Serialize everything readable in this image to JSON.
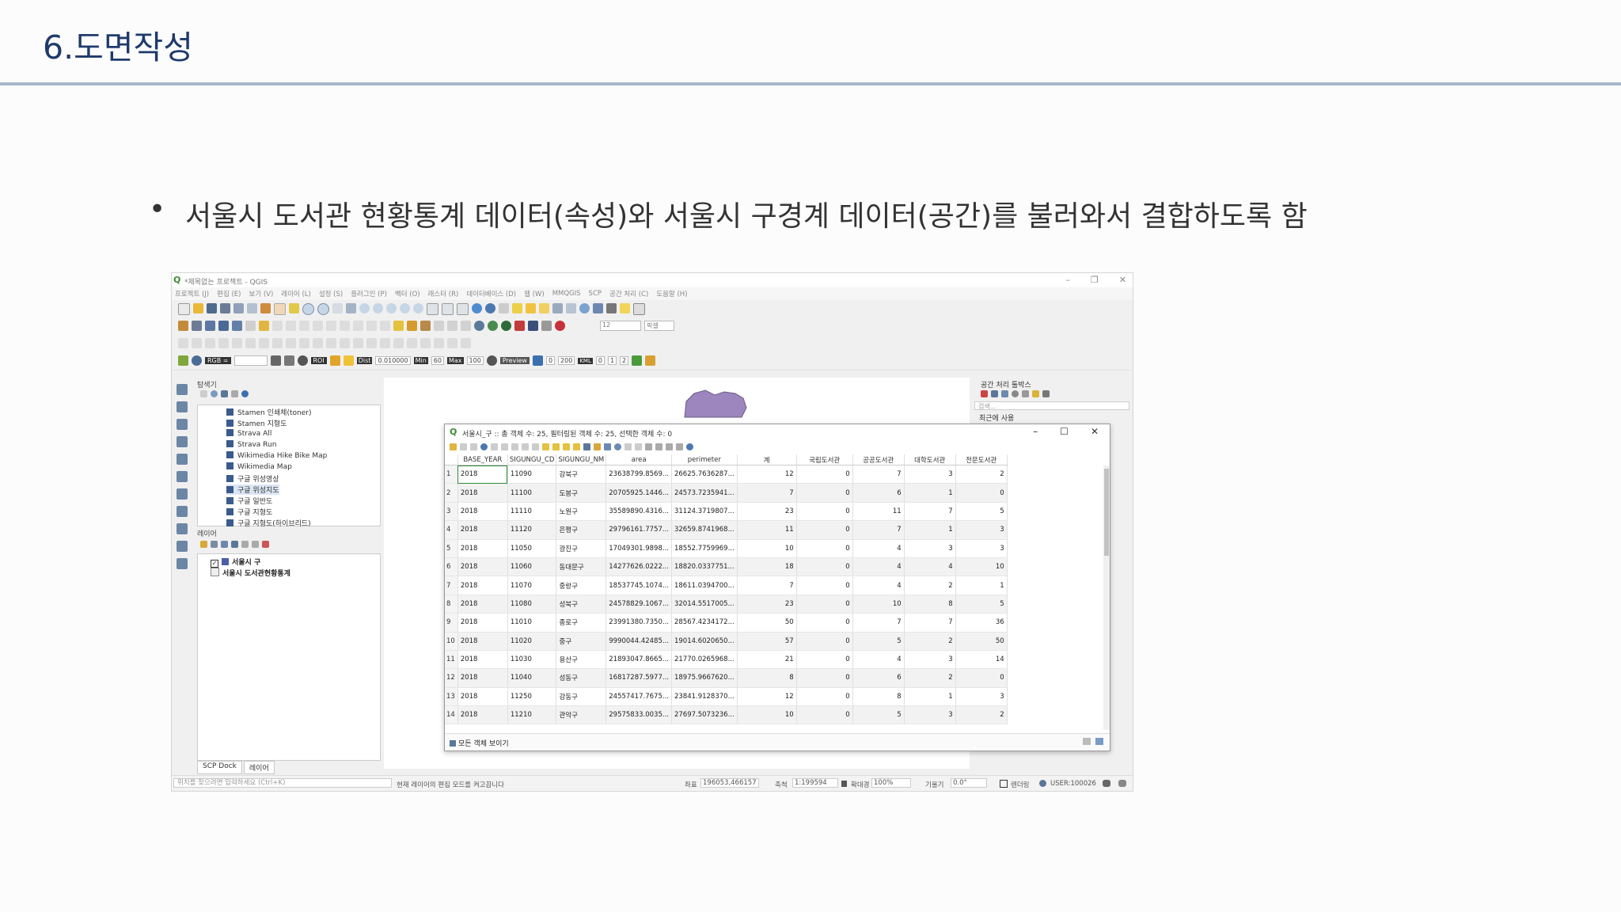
{
  "slide": {
    "title": "6.도면작성",
    "bullet_marker": "•",
    "bullet": "서울시 도서관 현황통계 데이터(속성)와 서울시 구경계 데이터(공간)를 불러와서 결합하도록 함"
  },
  "qgis": {
    "window_title": "*제목없는 프로젝트 - QGIS",
    "window_buttons": [
      "–",
      "❐",
      "✕"
    ],
    "menu": [
      "프로젝트 (J)",
      "편집 (E)",
      "보기 (V)",
      "레이어 (L)",
      "설정 (S)",
      "플러그인 (P)",
      "벡터 (O)",
      "래스터 (R)",
      "데이터베이스 (D)",
      "웹 (W)",
      "MMQGIS",
      "SCP",
      "공간 처리 (C)",
      "도움말 (H)"
    ],
    "toolbar4": {
      "rgb": "RGB =",
      "roi": "ROI",
      "dist_label": "Dist",
      "dist_value": "0.010000",
      "min_label": "Min",
      "min_value": "60",
      "max_label": "Max",
      "max_value": "100",
      "preview": "Preview",
      "n1": "0",
      "n200": "200",
      "kml": "KML",
      "v0": "0",
      "v1": "1",
      "v2": "2"
    },
    "toolbar2": {
      "font_size": "12",
      "unit": "픽셀"
    },
    "browser": {
      "title": "탐색기",
      "items": [
        "Stamen 인쇄체(toner)",
        "Stamen 지형도",
        "Strava All",
        "Strava Run",
        "Wikimedia Hike Bike Map",
        "Wikimedia Map",
        "구글 위성영상",
        "구글 위성지도",
        "구글 일반도",
        "구글 지형도",
        "구글 지형도(하이브리드)"
      ]
    },
    "layers": {
      "title": "레이어",
      "items": [
        "서울시 구",
        "서울시 도서관현황통계"
      ]
    },
    "bottom_tabs": [
      "SCP Dock",
      "레이어"
    ],
    "processing": {
      "title": "공간 처리 툴박스",
      "search_placeholder": "검색...",
      "recent": "최근에 사용"
    },
    "status": {
      "search_placeholder": "위치를 찾으려면 입력하세요 (Ctrl+K)",
      "message": "현재 레이어의 편집 모드를 켜고끕니다",
      "coord_label": "좌표",
      "coord_value": "196053,466157",
      "scale_label": "축척",
      "scale_value": "1:199594",
      "magnifier_label": "확대경",
      "magnifier_value": "100%",
      "rotation_label": "기울기",
      "rotation_value": "0.0°",
      "render_label": "렌더링",
      "crs": "USER:100026"
    }
  },
  "attribute_table": {
    "title": "서울시_구 :: 총 객체 수: 25, 필터링된 객체 수: 25, 선택한 객체 수: 0",
    "columns": [
      "BASE_YEAR",
      "SIGUNGU_CD",
      "SIGUNGU_NM",
      "area",
      "perimeter",
      "계",
      "국립도서관",
      "공공도서관",
      "대학도서관",
      "전문도서관"
    ],
    "rows": [
      [
        "1",
        "2018",
        "11090",
        "강북구",
        "23638799.8569...",
        "26625.7636287...",
        "12",
        "0",
        "7",
        "3",
        "2"
      ],
      [
        "2",
        "2018",
        "11100",
        "도봉구",
        "20705925.1446...",
        "24573.7235941...",
        "7",
        "0",
        "6",
        "1",
        "0"
      ],
      [
        "3",
        "2018",
        "11110",
        "노원구",
        "35589890.4316...",
        "31124.3719807...",
        "23",
        "0",
        "11",
        "7",
        "5"
      ],
      [
        "4",
        "2018",
        "11120",
        "은평구",
        "29796161.7757...",
        "32659.8741968...",
        "11",
        "0",
        "7",
        "1",
        "3"
      ],
      [
        "5",
        "2018",
        "11050",
        "광진구",
        "17049301.9898...",
        "18552.7759969...",
        "10",
        "0",
        "4",
        "3",
        "3"
      ],
      [
        "6",
        "2018",
        "11060",
        "동대문구",
        "14277626.0222...",
        "18820.0337751...",
        "18",
        "0",
        "4",
        "4",
        "10"
      ],
      [
        "7",
        "2018",
        "11070",
        "중랑구",
        "18537745.1074...",
        "18611.0394700...",
        "7",
        "0",
        "4",
        "2",
        "1"
      ],
      [
        "8",
        "2018",
        "11080",
        "성북구",
        "24578829.1067...",
        "32014.5517005...",
        "23",
        "0",
        "10",
        "8",
        "5"
      ],
      [
        "9",
        "2018",
        "11010",
        "종로구",
        "23991380.7350...",
        "28567.4234172...",
        "50",
        "0",
        "7",
        "7",
        "36"
      ],
      [
        "10",
        "2018",
        "11020",
        "중구",
        "9990044.42485...",
        "19014.6020650...",
        "57",
        "0",
        "5",
        "2",
        "50"
      ],
      [
        "11",
        "2018",
        "11030",
        "용산구",
        "21893047.8665...",
        "21770.0265968...",
        "21",
        "0",
        "4",
        "3",
        "14"
      ],
      [
        "12",
        "2018",
        "11040",
        "성동구",
        "16817287.5977...",
        "18975.9667620...",
        "8",
        "0",
        "6",
        "2",
        "0"
      ],
      [
        "13",
        "2018",
        "11250",
        "강동구",
        "24557417.7675...",
        "23841.9128370...",
        "12",
        "0",
        "8",
        "1",
        "3"
      ],
      [
        "14",
        "2018",
        "11210",
        "관악구",
        "29575833.0035...",
        "27697.5073236...",
        "10",
        "0",
        "5",
        "3",
        "2"
      ]
    ],
    "footer_filter": "모든 객체 보이기",
    "window_buttons": [
      "–",
      "☐",
      "✕"
    ]
  },
  "colors": {
    "title": "#1f3a6b",
    "rule": "#a9b7cc",
    "map_polygon": "#9d85bd",
    "selection_outline": "#2c8a3a"
  }
}
